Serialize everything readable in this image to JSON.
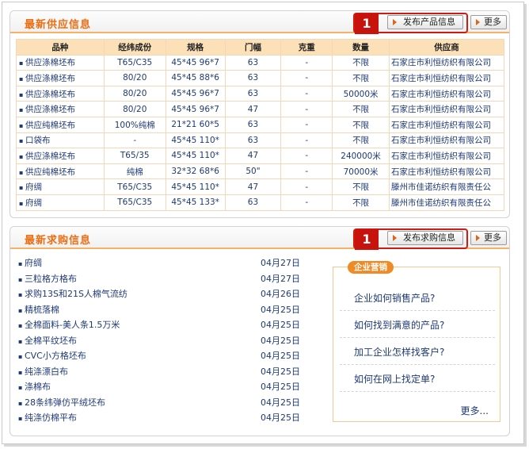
{
  "supply": {
    "title": "最新供应信息",
    "callout_number": "1",
    "publish_label": "发布产品信息",
    "more_label": "更多",
    "columns": [
      "品种",
      "经纬成份",
      "规格",
      "门幅",
      "克重",
      "数量",
      "供应商"
    ],
    "rows": [
      [
        "供应涤棉坯布",
        "T65/C35",
        "45*45 96*7",
        "63",
        "-",
        "不限",
        "石家庄市利恒纺织有限公司"
      ],
      [
        "供应涤棉坯布",
        "80/20",
        "45*45 88*6",
        "63",
        "-",
        "不限",
        "石家庄市利恒纺织有限公司"
      ],
      [
        "供应涤棉坯布",
        "80/20",
        "45*45 96*7",
        "63",
        "-",
        "50000米",
        "石家庄市利恒纺织有限公司"
      ],
      [
        "供应涤棉坯布",
        "80/20",
        "45*45 96*7",
        "47",
        "-",
        "不限",
        "石家庄市利恒纺织有限公司"
      ],
      [
        "供应纯棉坯布",
        "100%纯棉",
        "21*21 60*5",
        "63",
        "-",
        "不限",
        "石家庄市利恒纺织有限公司"
      ],
      [
        "口袋布",
        "-",
        "45*45 110*",
        "63",
        "-",
        "不限",
        "石家庄市利恒纺织有限公司"
      ],
      [
        "供应涤棉坯布",
        "T65/35",
        "45*45 110*",
        "47",
        "-",
        "240000米",
        "石家庄市利恒纺织有限公司"
      ],
      [
        "供应纯棉坯布",
        "纯棉",
        "32*32 68*6",
        "50\"",
        "-",
        "70000米",
        "石家庄市利恒纺织有限公司"
      ],
      [
        "府绸",
        "T65/C35",
        "45*45 110*",
        "47",
        "-",
        "不限",
        "滕州市佳诺纺织有限责任公"
      ],
      [
        "府绸",
        "T65/C35",
        "45*45 133*",
        "63",
        "-",
        "不限",
        "滕州市佳诺纺织有限责任公"
      ]
    ]
  },
  "demand": {
    "title": "最新求购信息",
    "callout_number": "1",
    "publish_label": "发布求购信息",
    "more_label": "更多",
    "items": [
      {
        "title": "府绸",
        "date": "04月27日"
      },
      {
        "title": "三粒格方格布",
        "date": "04月27日"
      },
      {
        "title": "求购13S和21S人棉气流纺",
        "date": "04月26日"
      },
      {
        "title": "精梳落棉",
        "date": "04月25日"
      },
      {
        "title": "全棉面料-美人条1.5万米",
        "date": "04月25日"
      },
      {
        "title": "全棉平纹坯布",
        "date": "04月25日"
      },
      {
        "title": "CVC小方格坯布",
        "date": "04月25日"
      },
      {
        "title": "纯涤漂白布",
        "date": "04月25日"
      },
      {
        "title": "涤棉布",
        "date": "04月25日"
      },
      {
        "title": "28条纬弹仿平绒坯布",
        "date": "04月25日"
      },
      {
        "title": "纯涤仿棉平布",
        "date": "04月25日"
      }
    ]
  },
  "marketing": {
    "tag": "企业营销",
    "questions": [
      "企业如何销售产品?",
      "如何找到满意的产品?",
      "加工企业怎样找客户?",
      "如何在网上找定单?"
    ],
    "more": "更多..."
  },
  "colors": {
    "title_orange": "#ec6d12",
    "header_fill": "#fbe0b8",
    "callout_red": "#d11a12",
    "link_blue": "#1f3a78"
  }
}
